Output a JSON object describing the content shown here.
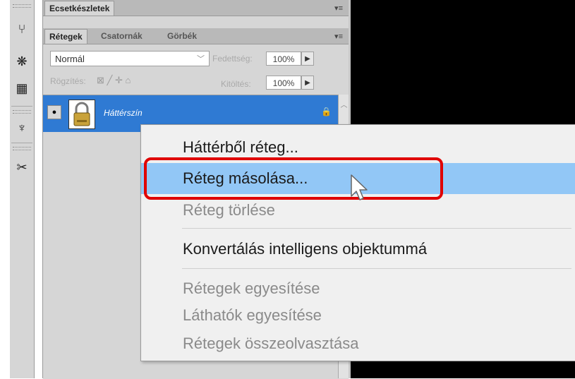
{
  "panel": {
    "top_tab": "Ecsetkészletek",
    "tabs": [
      "Rétegek",
      "Csatornák",
      "Görbék"
    ],
    "blend_mode": "Normál",
    "opacity_label": "Fedettség:",
    "opacity_value": "100%",
    "lock_label": "Rögzítés:",
    "fill_label": "Kitöltés:",
    "fill_value": "100%"
  },
  "layer": {
    "name": "Háttérszín"
  },
  "context_menu": {
    "items": [
      {
        "label": "Háttérből réteg...",
        "enabled": true
      },
      {
        "label": "Réteg másolása...",
        "enabled": true,
        "highlighted": true
      },
      {
        "label": "Réteg törlése",
        "enabled": false
      },
      {
        "label": "Konvertálás intelligens objektummá",
        "enabled": true
      },
      {
        "label": "Rétegek egyesítése",
        "enabled": false
      },
      {
        "label": "Láthatók egyesítése",
        "enabled": false
      },
      {
        "label": "Rétegek összeolvasztása",
        "enabled": false
      }
    ]
  },
  "colors": {
    "selection": "#2f7ad3",
    "menu_highlight": "#92c7f6",
    "annotation_ring": "#e00000"
  },
  "icons": [
    "history-icon",
    "navigator-icon",
    "swatches-icon",
    "brush-icon",
    "tools-icon",
    "eye-icon",
    "lock-icon",
    "panel-menu-icon"
  ]
}
